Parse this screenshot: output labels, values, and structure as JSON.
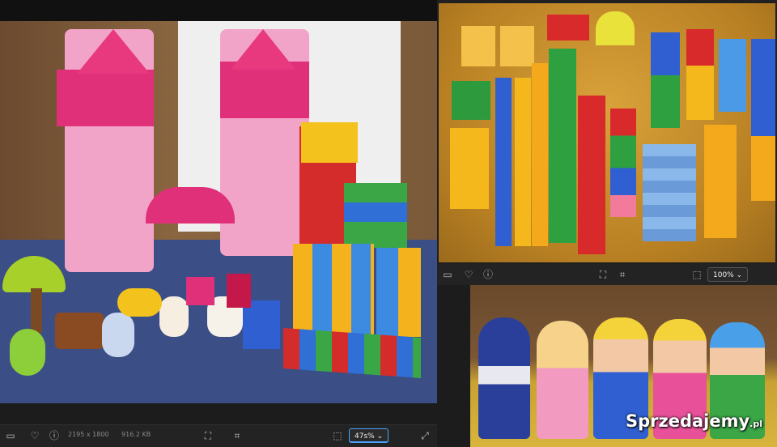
{
  "left_viewer": {
    "image_info": {
      "dimensions": "2195 x 1800",
      "file_size": "916.2 KB"
    },
    "zoom_value": "47s%",
    "icons": [
      "panel-toggle-icon",
      "heart-icon",
      "info-icon",
      "fit-screen-icon",
      "crop-icon",
      "fit-width-icon",
      "expand-icon"
    ]
  },
  "top_right_viewer": {
    "zoom_value": "100%",
    "icons": [
      "panel-toggle-icon",
      "heart-icon",
      "info-icon",
      "fit-screen-icon",
      "crop-icon",
      "fit-width-icon"
    ]
  },
  "bottom_right": {
    "watermark": {
      "text": "Sprzedajemy",
      "suffix": ".pl"
    }
  },
  "colors": {
    "accent": "#4aa3ff",
    "toolbar": "#232323",
    "background": "#202020"
  }
}
